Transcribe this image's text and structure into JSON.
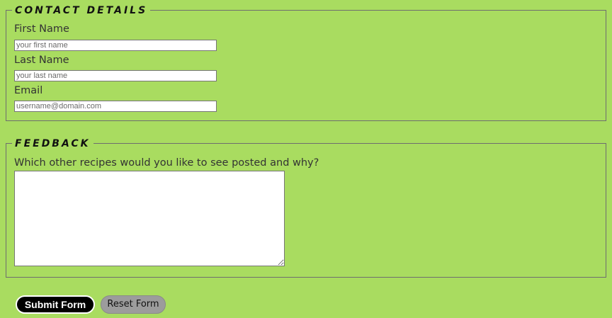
{
  "contact": {
    "legend": "CONTACT DETAILS",
    "first_name": {
      "label": "First Name",
      "value": "",
      "placeholder": "your first name"
    },
    "last_name": {
      "label": "Last Name",
      "value": "",
      "placeholder": "your last name"
    },
    "email": {
      "label": "Email",
      "value": "",
      "placeholder": "username@domain.com"
    }
  },
  "feedback": {
    "legend": "FEEDBACK",
    "question": "Which other recipes would you like to see posted and why?",
    "value": ""
  },
  "buttons": {
    "submit_label": "Submit Form",
    "reset_label": "Reset Form"
  },
  "colors": {
    "background": "#a9dc60",
    "submit_bg": "#000000",
    "reset_bg": "#9c9c9c"
  }
}
